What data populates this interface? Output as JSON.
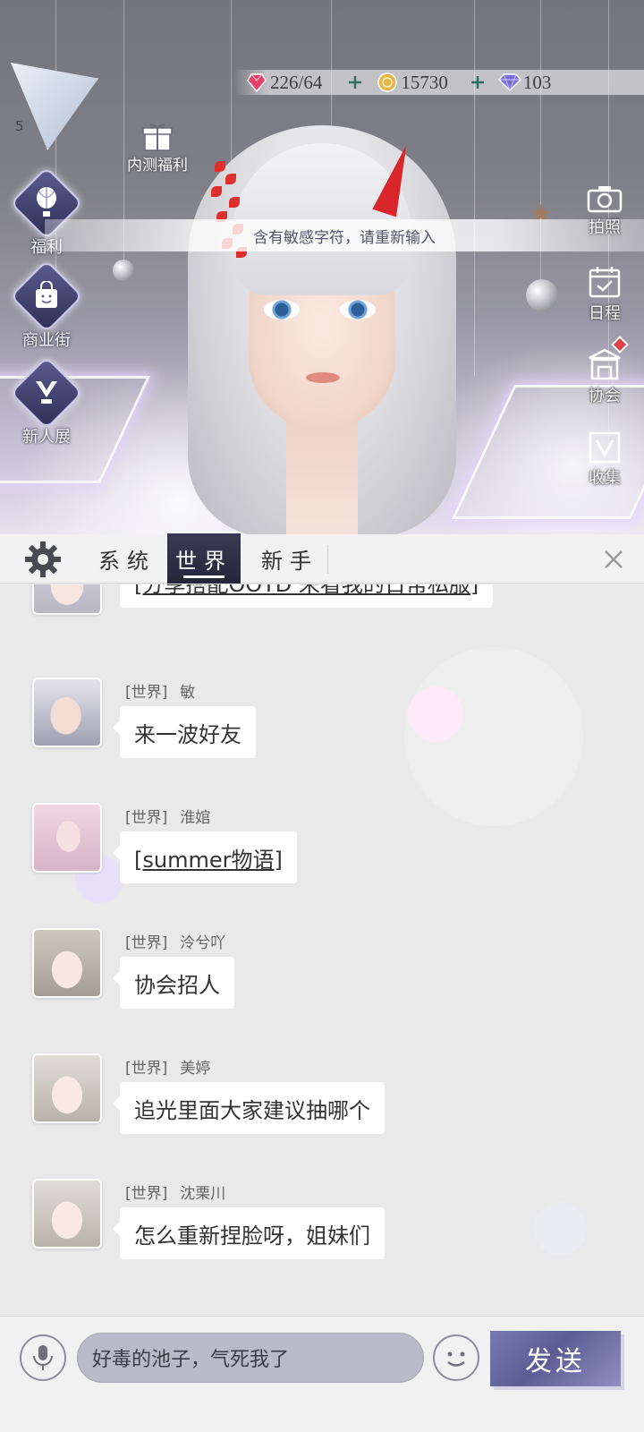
{
  "resources": {
    "stamina": {
      "value": "226/64",
      "icon": "heart-gem-icon",
      "color": "#e83e6a"
    },
    "gold": {
      "value": "15730",
      "icon": "gold-coin-icon",
      "color": "#e7b64b"
    },
    "diamond": {
      "value": "103",
      "icon": "diamond-icon",
      "color": "#7a6fd6"
    }
  },
  "player": {
    "level": "5"
  },
  "left_menu": [
    {
      "label": "福利",
      "icon": "balloon-icon"
    },
    {
      "label": "商业街",
      "icon": "shopping-bag-icon"
    },
    {
      "label": "新人展",
      "icon": "trophy-icon"
    }
  ],
  "gift": {
    "label": "内测福利",
    "icon": "gift-box-icon"
  },
  "right_menu": [
    {
      "label": "拍照",
      "icon": "camera-icon"
    },
    {
      "label": "日程",
      "icon": "calendar-icon"
    },
    {
      "label": "协会",
      "icon": "guild-hall-icon"
    },
    {
      "label": "收集",
      "icon": "collection-icon"
    }
  ],
  "toast": "含有敏感字符，请重新输入",
  "tabs": [
    {
      "label": "系统",
      "active": false
    },
    {
      "label": "世界",
      "active": true
    },
    {
      "label": "新手",
      "active": false
    }
  ],
  "messages": [
    {
      "channel": "",
      "name": "",
      "text": "[分享搭配OOTD 来看我的日常私服]",
      "link": true
    },
    {
      "channel": "[世界]",
      "name": "敏",
      "text": "来一波好友",
      "link": false
    },
    {
      "channel": "[世界]",
      "name": "淮婠",
      "text": "[summer物语]",
      "link": true
    },
    {
      "channel": "[世界]",
      "name": "泠兮吖",
      "text": "协会招人",
      "link": false
    },
    {
      "channel": "[世界]",
      "name": "美婷",
      "text": "追光里面大家建议抽哪个",
      "link": false
    },
    {
      "channel": "[世界]",
      "name": "沈栗川",
      "text": "怎么重新捏脸呀，姐妹们",
      "link": false
    }
  ],
  "input": {
    "value": "好毒的池子，气死我了",
    "send_label": "发送"
  },
  "colors": {
    "accent": "#3a3a55",
    "panel": "#e9e9ea",
    "send": "#6b6da3"
  }
}
